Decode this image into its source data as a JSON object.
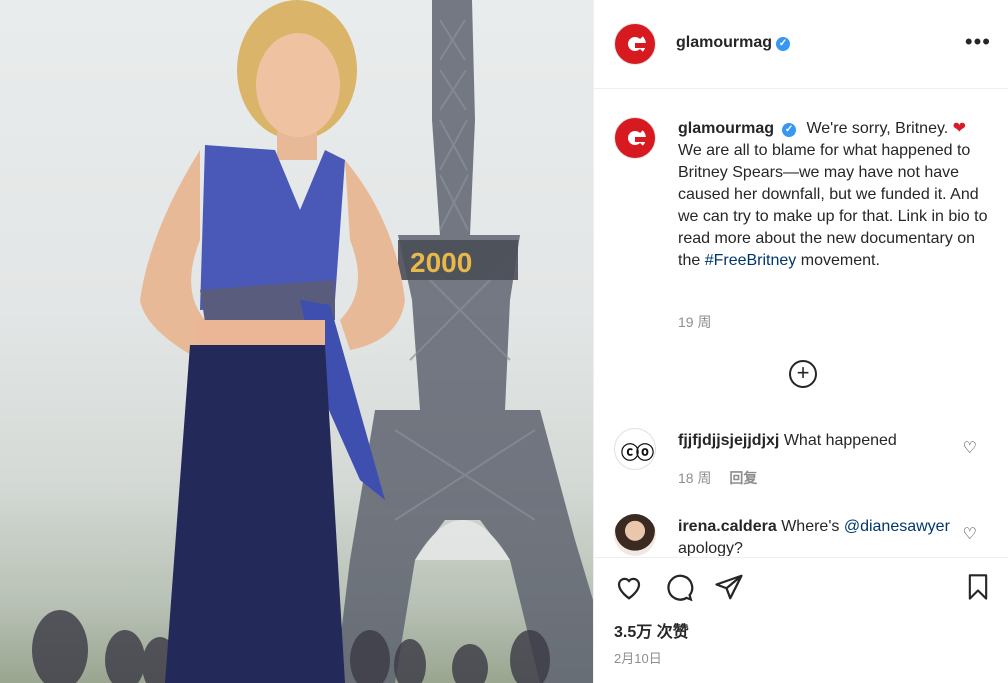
{
  "post": {
    "image_alt": "Britney Spears in front of Eiffel Tower",
    "sign_text": "2000"
  },
  "header": {
    "username": "glamourmag",
    "more_icon": "more-dots-icon"
  },
  "caption": {
    "username": "glamourmag",
    "text_before_heart": "We're sorry, Britney.",
    "heart": "❤",
    "text_main": "We are all to blame for what happened to Britney Spears—we may have not have caused her downfall, but we funded it. And we can try to make up for that. Link in bio to read more about the new documentary on the",
    "hashtag": "#FreeBritney",
    "text_after_hashtag": "movement.",
    "time": "19 周"
  },
  "add_comment_icon": "plus-circle-icon",
  "comments": [
    {
      "username": "fjjfjdjjsjejjdjxj",
      "text": "What happened",
      "time": "18 周",
      "reply_label": "回复"
    },
    {
      "username": "irena.caldera",
      "text": "Where's",
      "mention": "@dianesawyer",
      "text_after": "apology?"
    }
  ],
  "actions": {
    "likes": "3.5万 次赞",
    "date": "2月10日"
  },
  "colors": {
    "brand_red": "#d71920",
    "link_blue": "#00376b",
    "verified_blue": "#3897f0",
    "muted": "#8e8e8e"
  }
}
